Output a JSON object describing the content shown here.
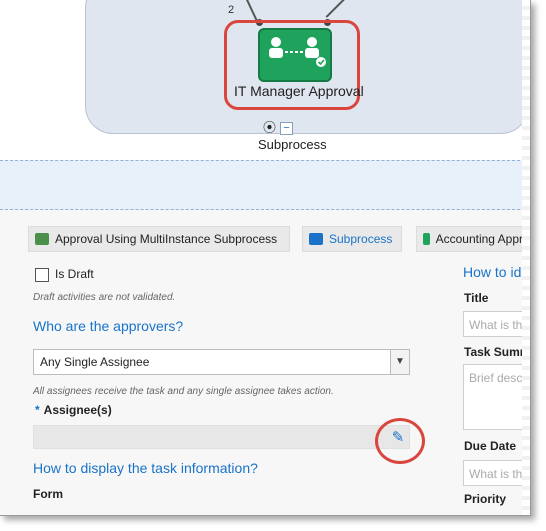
{
  "diagram": {
    "connector_label": "2",
    "task_title": "IT Manager Approval",
    "subprocess_label": "Subprocess",
    "collapse_symbol": "−"
  },
  "tabs": [
    {
      "label": "Approval Using MultiInstance Subprocess",
      "icon": "process-icon"
    },
    {
      "label": "Subprocess",
      "icon": "subprocess-icon"
    },
    {
      "label": "Accounting Appr",
      "icon": "approval-task-icon"
    }
  ],
  "form": {
    "is_draft_label": "Is Draft",
    "draft_hint": "Draft activities are not validated.",
    "approvers_heading": "Who are the approvers?",
    "approver_select_value": "Any Single Assignee",
    "approver_hint": "All assignees receive the task and any single assignee takes action.",
    "assignees_label": "Assignee(s)",
    "required_marker": "*",
    "display_heading": "How to display the task information?",
    "form_label": "Form"
  },
  "right_column": {
    "heading": "How to id",
    "title_label": "Title",
    "title_placeholder": "What is th",
    "summary_label": "Task Summ",
    "summary_placeholder": "Brief desc",
    "due_date_label": "Due Date",
    "due_date_placeholder": "What is th",
    "priority_label": "Priority"
  },
  "colors": {
    "accent": "#1a73c8",
    "task_green": "#1fa35c",
    "highlight_red": "#d9463e"
  }
}
